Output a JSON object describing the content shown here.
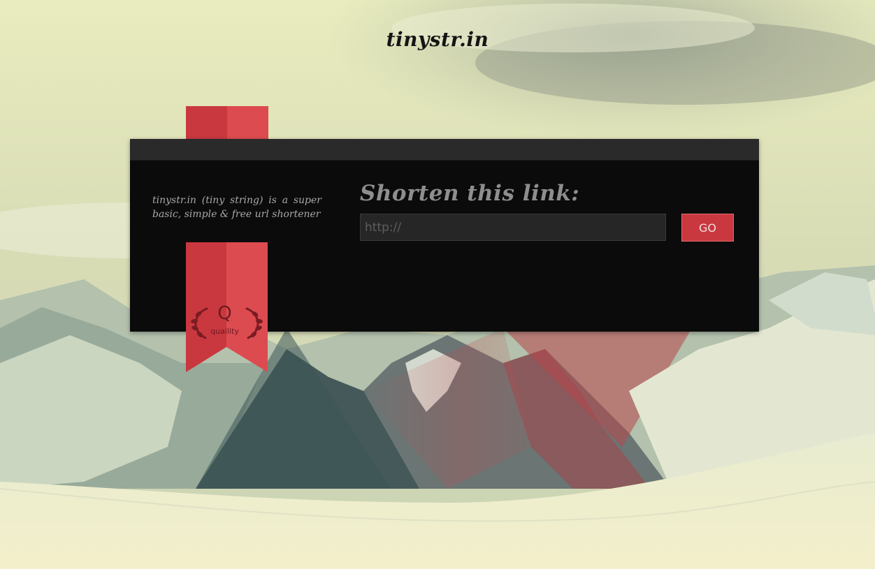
{
  "site": {
    "title": "tinystr.in"
  },
  "panel": {
    "tagline": "tinystr.in (tiny string) is a super basic, simple & free url shortener",
    "heading": "Shorten this link:"
  },
  "form": {
    "url_placeholder": "http://",
    "url_value": "",
    "go_label": "GO"
  },
  "badge": {
    "letter": "Q",
    "label": "quaility",
    "icon": "laurel-wreath-icon"
  },
  "colors": {
    "ribbon_dark": "#c9383f",
    "ribbon_light": "#dc4b50",
    "panel_bg": "#0b0b0b",
    "button_bg": "#c9383f",
    "heading_text": "#8e8e8e"
  }
}
